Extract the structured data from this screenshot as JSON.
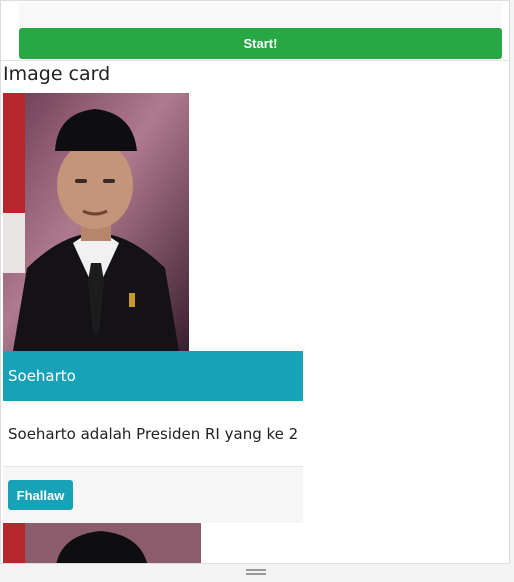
{
  "top": {
    "start_label": "Start!"
  },
  "section": {
    "title": "Image card"
  },
  "card": {
    "image_alt": "Soeharto portrait",
    "header": "Soeharto",
    "body": "Soeharto adalah Presiden RI yang ke 2",
    "button_label": "Fhallaw"
  },
  "colors": {
    "start_button": "#28a745",
    "card_accent": "#17a2b8"
  },
  "icons": {
    "resize_handle": "drag-handle-icon"
  }
}
